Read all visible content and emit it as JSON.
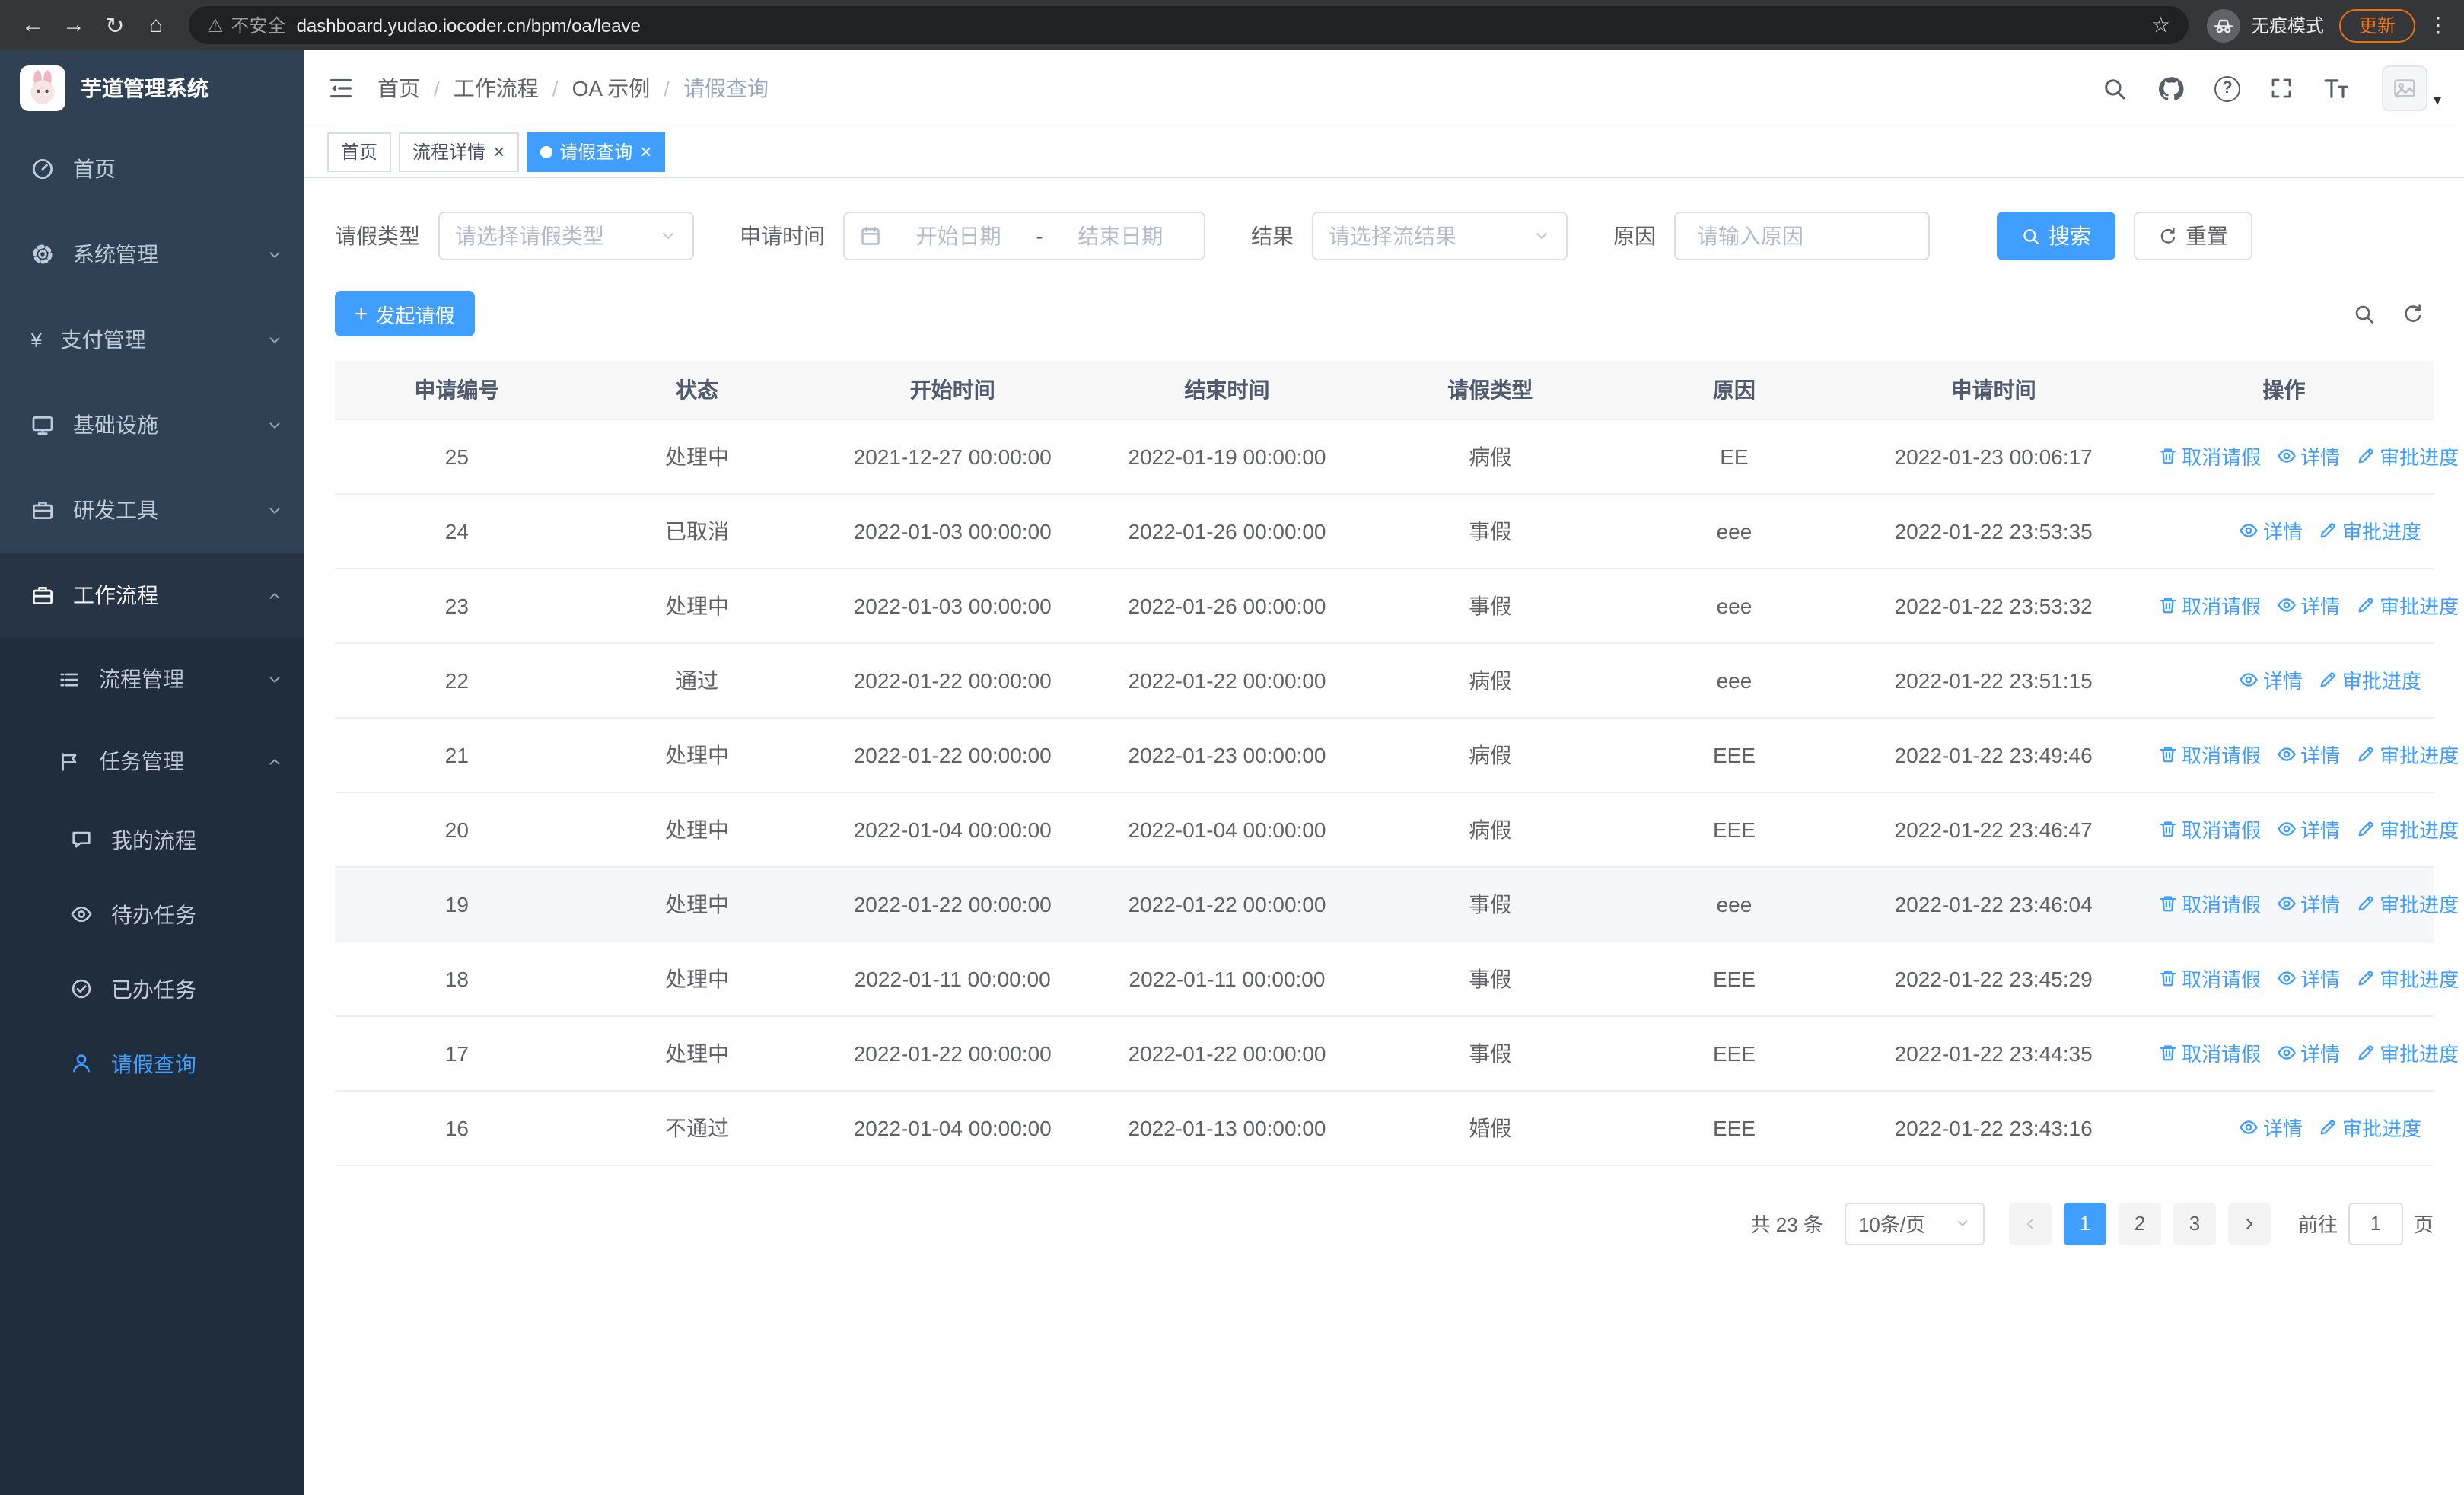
{
  "browser": {
    "security_label": "不安全",
    "url": "dashboard.yudao.iocoder.cn/bpm/oa/leave",
    "incognito_label": "无痕模式",
    "update_label": "更新"
  },
  "glyphs": {
    "back": "←",
    "forward": "→",
    "reload": "↻",
    "home": "⌂",
    "warning": "⚠",
    "star": "☆",
    "kebab": "⋮",
    "question": "?",
    "yen": "¥",
    "caret_down": "▾",
    "close": "×",
    "plus": "+",
    "range_separator": "-"
  },
  "app_title": "芋道管理系统",
  "sidebar": {
    "items": [
      "首页",
      "系统管理",
      "支付管理",
      "基础设施",
      "研发工具",
      "工作流程"
    ],
    "process_mgmt_label": "流程管理",
    "task_mgmt_label": "任务管理",
    "task_children": [
      "我的流程",
      "待办任务",
      "已办任务",
      "请假查询"
    ]
  },
  "breadcrumb": [
    "首页",
    "工作流程",
    "OA 示例",
    "请假查询"
  ],
  "tabs": [
    {
      "label": "首页"
    },
    {
      "label": "流程详情"
    },
    {
      "label": "请假查询"
    }
  ],
  "filters": {
    "type_label": "请假类型",
    "type_placeholder": "请选择请假类型",
    "time_label": "申请时间",
    "time_start_placeholder": "开始日期",
    "time_end_placeholder": "结束日期",
    "result_label": "结果",
    "result_placeholder": "请选择流结果",
    "reason_label": "原因",
    "reason_placeholder": "请输入原因",
    "search_button": "搜索",
    "reset_button": "重置"
  },
  "toolbar": {
    "create_button": "发起请假"
  },
  "table": {
    "columns": [
      "申请编号",
      "状态",
      "开始时间",
      "结束时间",
      "请假类型",
      "原因",
      "申请时间",
      "操作"
    ],
    "action_labels": {
      "cancel": "取消请假",
      "detail": "详情",
      "progress": "审批进度"
    },
    "rows": [
      {
        "id": "25",
        "status": "处理中",
        "start": "2021-12-27 00:00:00",
        "end": "2022-01-19 00:00:00",
        "type": "病假",
        "reason": "EE",
        "applied": "2022-01-23 00:06:17",
        "actions": [
          "cancel",
          "detail",
          "progress"
        ]
      },
      {
        "id": "24",
        "status": "已取消",
        "start": "2022-01-03 00:00:00",
        "end": "2022-01-26 00:00:00",
        "type": "事假",
        "reason": "eee",
        "applied": "2022-01-22 23:53:35",
        "actions": [
          "detail",
          "progress"
        ]
      },
      {
        "id": "23",
        "status": "处理中",
        "start": "2022-01-03 00:00:00",
        "end": "2022-01-26 00:00:00",
        "type": "事假",
        "reason": "eee",
        "applied": "2022-01-22 23:53:32",
        "actions": [
          "cancel",
          "detail",
          "progress"
        ]
      },
      {
        "id": "22",
        "status": "通过",
        "start": "2022-01-22 00:00:00",
        "end": "2022-01-22 00:00:00",
        "type": "病假",
        "reason": "eee",
        "applied": "2022-01-22 23:51:15",
        "actions": [
          "detail",
          "progress"
        ]
      },
      {
        "id": "21",
        "status": "处理中",
        "start": "2022-01-22 00:00:00",
        "end": "2022-01-23 00:00:00",
        "type": "病假",
        "reason": "EEE",
        "applied": "2022-01-22 23:49:46",
        "actions": [
          "cancel",
          "detail",
          "progress"
        ]
      },
      {
        "id": "20",
        "status": "处理中",
        "start": "2022-01-04 00:00:00",
        "end": "2022-01-04 00:00:00",
        "type": "病假",
        "reason": "EEE",
        "applied": "2022-01-22 23:46:47",
        "actions": [
          "cancel",
          "detail",
          "progress"
        ]
      },
      {
        "id": "19",
        "status": "处理中",
        "start": "2022-01-22 00:00:00",
        "end": "2022-01-22 00:00:00",
        "type": "事假",
        "reason": "eee",
        "applied": "2022-01-22 23:46:04",
        "actions": [
          "cancel",
          "detail",
          "progress"
        ],
        "highlighted": true
      },
      {
        "id": "18",
        "status": "处理中",
        "start": "2022-01-11 00:00:00",
        "end": "2022-01-11 00:00:00",
        "type": "事假",
        "reason": "EEE",
        "applied": "2022-01-22 23:45:29",
        "actions": [
          "cancel",
          "detail",
          "progress"
        ]
      },
      {
        "id": "17",
        "status": "处理中",
        "start": "2022-01-22 00:00:00",
        "end": "2022-01-22 00:00:00",
        "type": "事假",
        "reason": "EEE",
        "applied": "2022-01-22 23:44:35",
        "actions": [
          "cancel",
          "detail",
          "progress"
        ]
      },
      {
        "id": "16",
        "status": "不通过",
        "start": "2022-01-04 00:00:00",
        "end": "2022-01-13 00:00:00",
        "type": "婚假",
        "reason": "EEE",
        "applied": "2022-01-22 23:43:16",
        "actions": [
          "detail",
          "progress"
        ]
      }
    ]
  },
  "pagination": {
    "total_label": "共 23 条",
    "page_size": "10条/页",
    "pages": [
      "1",
      "2",
      "3"
    ],
    "goto_label": "前往",
    "goto_value": "1",
    "goto_suffix": "页"
  },
  "colors": {
    "primary": "#409eff",
    "sidebar_bg": "#304156",
    "sidebar_sub_bg": "#1f2d3d"
  }
}
